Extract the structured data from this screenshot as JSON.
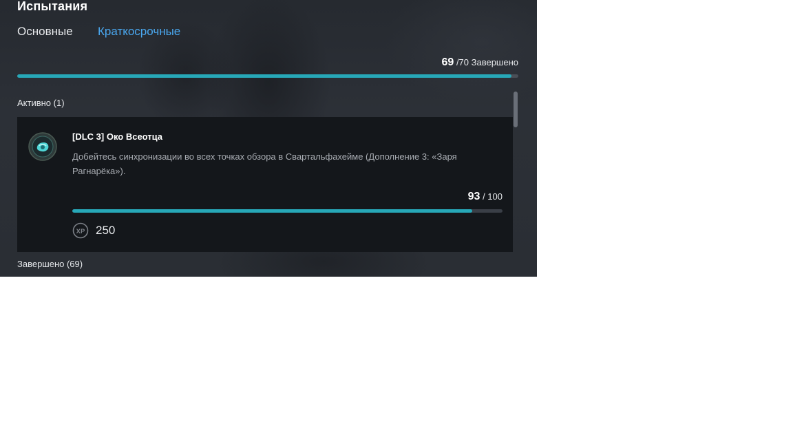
{
  "header": {
    "title": "Испытания"
  },
  "tabs": [
    {
      "label": "Основные",
      "active": false
    },
    {
      "label": "Краткосрочные",
      "active": true
    }
  ],
  "overall_progress": {
    "completed": "69",
    "total_text": "/70 Завершено",
    "fraction": 0.9857
  },
  "sections": {
    "active_label": "Активно (1)",
    "completed_label": "Завершено (69)"
  },
  "challenge": {
    "title": "[DLC 3] Око Всеотца",
    "description": "Добейтесь синхронизации во всех точках обзора в Свартальфахейме (Дополнение 3: «Заря Рагнарёка»).",
    "progress_current": "93",
    "progress_total_text": "/ 100",
    "fraction": 0.93,
    "reward_icon": "xp-icon",
    "reward_icon_text": "XP",
    "reward_value": "250"
  },
  "colors": {
    "accent_tab": "#4aa8f0",
    "progress_fill": "#27a8b8",
    "card_bg": "#14171b",
    "panel_bg": "#2a2e35"
  }
}
